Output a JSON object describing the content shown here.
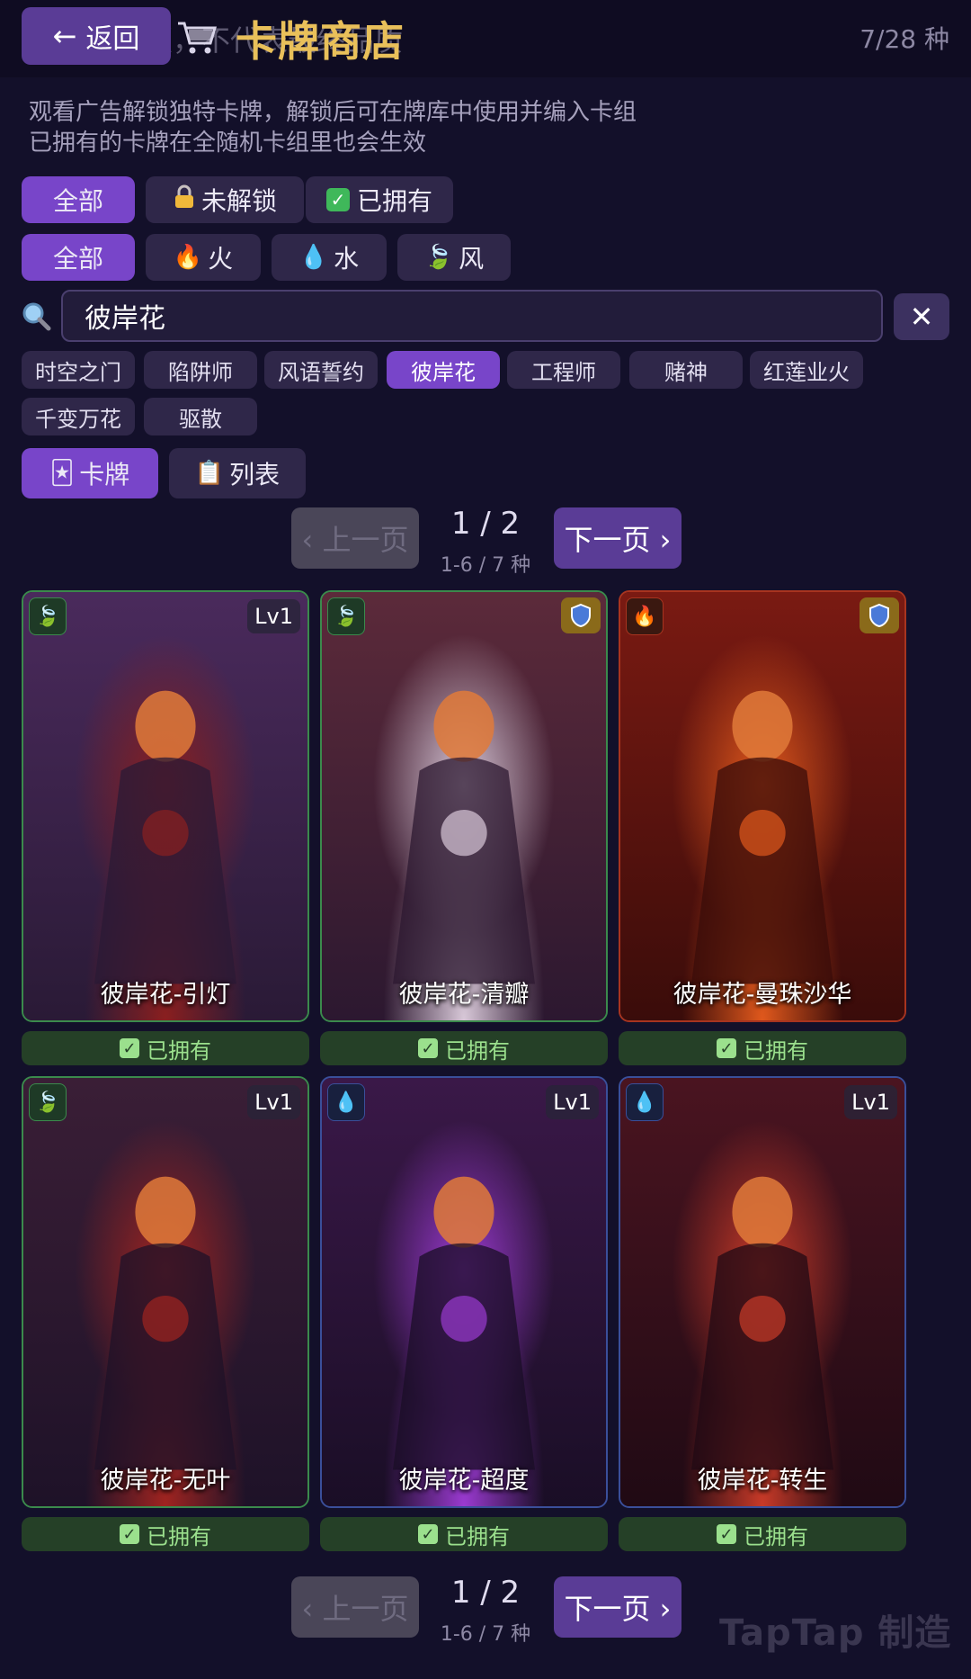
{
  "header": {
    "watermark": "研发测试版，不代表最终品质",
    "back_label": "返回",
    "title": "卡牌商店",
    "count": "7/28 种"
  },
  "description": {
    "line1": "观看广告解锁独特卡牌，解锁后可在牌库中使用并编入卡组",
    "line2": "已拥有的卡牌在全随机卡组里也会生效"
  },
  "ownership_filters": [
    {
      "label": "全部",
      "icon": "",
      "active": true
    },
    {
      "label": "未解锁",
      "icon": "🔒",
      "active": false
    },
    {
      "label": "已拥有",
      "icon": "✓",
      "active": false
    }
  ],
  "element_filters": [
    {
      "label": "全部",
      "icon": "",
      "active": true
    },
    {
      "label": "火",
      "icon": "🔥",
      "active": false
    },
    {
      "label": "水",
      "icon": "💧",
      "active": false
    },
    {
      "label": "风",
      "icon": "🍃",
      "active": false
    }
  ],
  "search": {
    "value": "彼岸花",
    "clear_label": "✕"
  },
  "tags": [
    {
      "label": "时空之门",
      "active": false
    },
    {
      "label": "陷阱师",
      "active": false
    },
    {
      "label": "风语誓约",
      "active": false
    },
    {
      "label": "彼岸花",
      "active": true
    },
    {
      "label": "工程师",
      "active": false
    },
    {
      "label": "赌神",
      "active": false
    },
    {
      "label": "红莲业火",
      "active": false
    },
    {
      "label": "千变万花",
      "active": false
    },
    {
      "label": "驱散",
      "active": false
    }
  ],
  "view_modes": [
    {
      "label": "卡牌",
      "icon": "🃏",
      "active": true
    },
    {
      "label": "列表",
      "icon": "📋",
      "active": false
    }
  ],
  "pager": {
    "prev_label": "‹ 上一页",
    "next_label": "下一页 ›",
    "page": "1 / 2",
    "range": "1-6 / 7 种"
  },
  "cards": [
    {
      "name": "彼岸花-引灯",
      "element": "wind",
      "level": "Lv1",
      "type_badge": "",
      "frame": "green",
      "status": "已拥有",
      "colors": [
        "#4a2a5c",
        "#2a1a36",
        "#8a1f1f"
      ]
    },
    {
      "name": "彼岸花-清瓣",
      "element": "wind",
      "level": "",
      "type_badge": "shield",
      "frame": "green",
      "status": "已拥有",
      "colors": [
        "#5c2a3a",
        "#2c1830",
        "#d8c8d8"
      ]
    },
    {
      "name": "彼岸花-曼珠沙华",
      "element": "fire",
      "level": "",
      "type_badge": "shield",
      "frame": "red",
      "status": "已拥有",
      "colors": [
        "#7a1a12",
        "#3a0c0a",
        "#e0581c"
      ]
    },
    {
      "name": "彼岸花-无叶",
      "element": "wind",
      "level": "Lv1",
      "type_badge": "",
      "frame": "green",
      "status": "已拥有",
      "colors": [
        "#3a1e36",
        "#1e1228",
        "#a02420"
      ]
    },
    {
      "name": "彼岸花-超度",
      "element": "water",
      "level": "Lv1",
      "type_badge": "",
      "frame": "blue",
      "status": "已拥有",
      "colors": [
        "#3a1848",
        "#1a0e26",
        "#9a3ad0"
      ]
    },
    {
      "name": "彼岸花-转生",
      "element": "water",
      "level": "Lv1",
      "type_badge": "",
      "frame": "blue",
      "status": "已拥有",
      "colors": [
        "#4a1420",
        "#200a14",
        "#c83a28"
      ]
    }
  ],
  "footer": {
    "brand": "TapTap 制造"
  }
}
